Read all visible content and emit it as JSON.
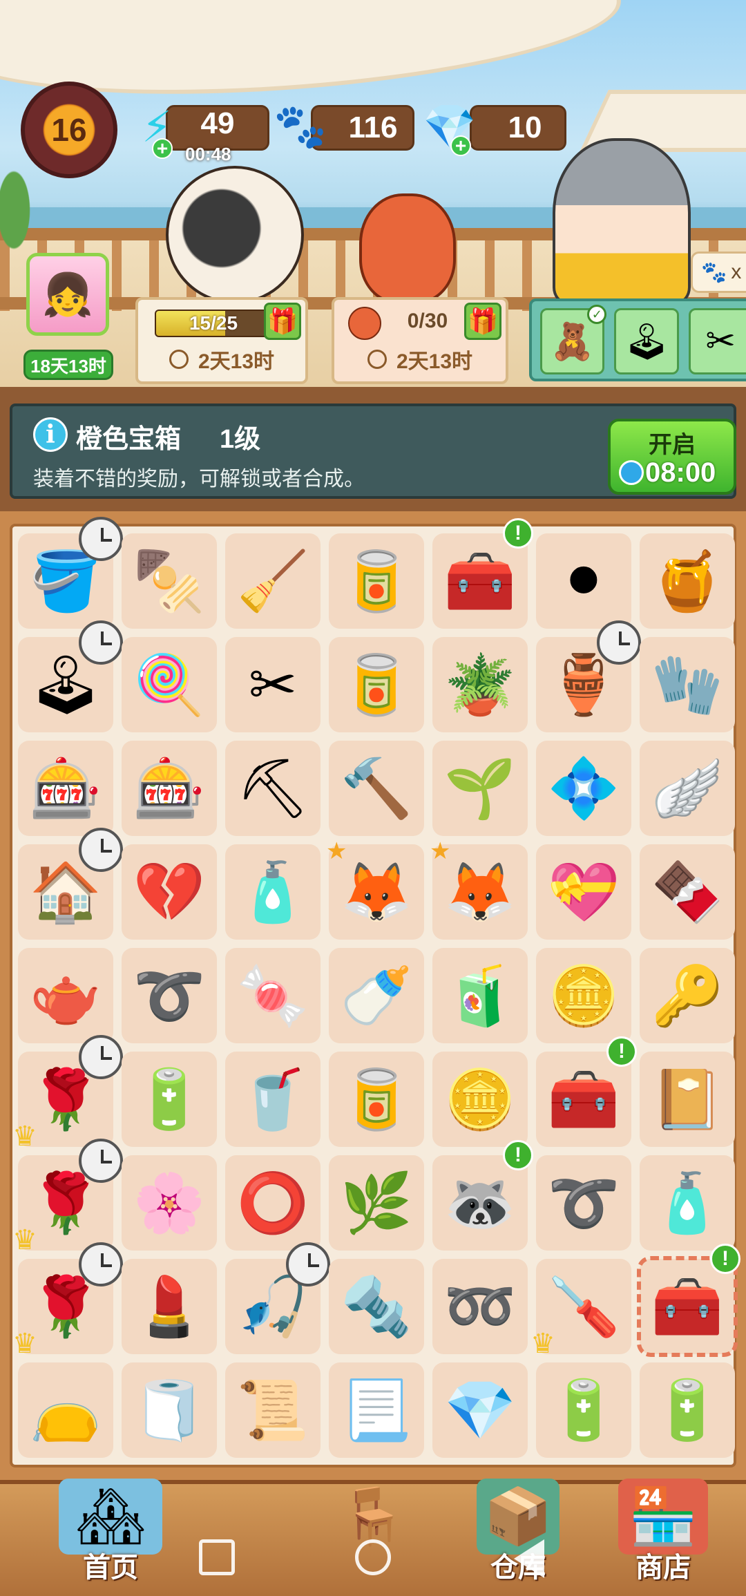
{
  "hud": {
    "level": "16",
    "energy": {
      "value": "49",
      "timer": "00:48",
      "icon": "lightning-icon"
    },
    "paws": {
      "value": "116",
      "icon": "paw-icon"
    },
    "gems": {
      "value": "10",
      "icon": "diamond-icon"
    }
  },
  "avatar": {
    "timer": "18天13时"
  },
  "events": [
    {
      "progress_text": "15/25",
      "progress": 0.6,
      "time": "2天13时"
    },
    {
      "progress_text": "0/30",
      "progress": 0.0,
      "time": "2天13时"
    }
  ],
  "paw_tag": "x",
  "info": {
    "title": "橙色宝箱",
    "level": "1级",
    "description": "装着不错的奖励，可解锁或者合成。",
    "button_label": "开启",
    "button_time": "08:00"
  },
  "board": {
    "rows": [
      [
        {
          "name": "wooden-tub",
          "icon": "🪣",
          "badge": "clock"
        },
        {
          "name": "bbq-grill",
          "icon": "🍢"
        },
        {
          "name": "rake",
          "icon": "🧹"
        },
        {
          "name": "paint-cans",
          "icon": "🥫"
        },
        {
          "name": "purple-chest",
          "icon": "🧰",
          "badge": "alert"
        },
        {
          "name": "go-board",
          "icon": "⚫"
        },
        {
          "name": "cobweb-pot",
          "icon": "🍯"
        }
      ],
      [
        {
          "name": "claw-machine-frame",
          "icon": "🕹",
          "badge": "clock"
        },
        {
          "name": "cotton-candy-machine",
          "icon": "🍭"
        },
        {
          "name": "pruning-shears",
          "icon": "✂"
        },
        {
          "name": "tin-can",
          "icon": "🥫"
        },
        {
          "name": "potted-fruit-plant",
          "icon": "🪴"
        },
        {
          "name": "bow-vase",
          "icon": "🏺",
          "badge": "clock"
        },
        {
          "name": "work-glove",
          "icon": "🧤"
        }
      ],
      [
        {
          "name": "claw-machine",
          "icon": "🎰"
        },
        {
          "name": "claw-machine",
          "icon": "🎰"
        },
        {
          "name": "shovel",
          "icon": "⛏"
        },
        {
          "name": "scraper",
          "icon": "🔨"
        },
        {
          "name": "sprout-pot",
          "icon": "🌱"
        },
        {
          "name": "glass-tray",
          "icon": "💠"
        },
        {
          "name": "rainbow-wing",
          "icon": "🪽"
        }
      ],
      [
        {
          "name": "cat-house",
          "icon": "🏠",
          "badge": "clock"
        },
        {
          "name": "broken-heart",
          "icon": "💔"
        },
        {
          "name": "spray-bottle",
          "icon": "🧴"
        },
        {
          "name": "fox-sticker",
          "icon": "🦊",
          "badge": "star"
        },
        {
          "name": "fox-goggles-sticker",
          "icon": "🦊",
          "badge": "star"
        },
        {
          "name": "rose-heart-box",
          "icon": "💝"
        },
        {
          "name": "chocolate-tray",
          "icon": "🍫"
        }
      ],
      [
        {
          "name": "gold-watering-can",
          "icon": "🫖"
        },
        {
          "name": "twine",
          "icon": "➰"
        },
        {
          "name": "candy",
          "icon": "🍬"
        },
        {
          "name": "milk-bottle",
          "icon": "🍼"
        },
        {
          "name": "water-bottle",
          "icon": "🧃"
        },
        {
          "name": "gold-paw-coins",
          "icon": "🪙"
        },
        {
          "name": "fox-keychain",
          "icon": "🔑"
        }
      ],
      [
        {
          "name": "rose-pot",
          "icon": "🌹",
          "badge": "clock",
          "crown": true
        },
        {
          "name": "battery",
          "icon": "🔋"
        },
        {
          "name": "red-drink",
          "icon": "🥤"
        },
        {
          "name": "cola-can",
          "icon": "🥫"
        },
        {
          "name": "gold-paw-coins",
          "icon": "🪙"
        },
        {
          "name": "purple-chest",
          "icon": "🧰",
          "badge": "alert"
        },
        {
          "name": "moon-book",
          "icon": "📔"
        }
      ],
      [
        {
          "name": "rose-pot",
          "icon": "🌹",
          "badge": "clock",
          "crown": true
        },
        {
          "name": "petals",
          "icon": "🌸"
        },
        {
          "name": "pet-collar",
          "icon": "⭕"
        },
        {
          "name": "crystal-plant",
          "icon": "🌿"
        },
        {
          "name": "raccoon-sticker",
          "icon": "🦝",
          "badge": "alert"
        },
        {
          "name": "string",
          "icon": "➰"
        },
        {
          "name": "cobweb-jug",
          "icon": "🧴"
        }
      ],
      [
        {
          "name": "rose-pot",
          "icon": "🌹",
          "badge": "clock",
          "crown": true
        },
        {
          "name": "lipstick",
          "icon": "💄"
        },
        {
          "name": "fishing-rod",
          "icon": "🎣",
          "badge": "clock"
        },
        {
          "name": "metal-tube",
          "icon": "🔩"
        },
        {
          "name": "rope",
          "icon": "➿"
        },
        {
          "name": "screwdriver",
          "icon": "🪛",
          "crown": true
        },
        {
          "name": "orange-chest",
          "icon": "🧰",
          "badge": "alert",
          "selected": true
        }
      ],
      [
        {
          "name": "gold-pouch",
          "icon": "👝"
        },
        {
          "name": "gold-cloth",
          "icon": "🧻"
        },
        {
          "name": "gold-scraps",
          "icon": "📜"
        },
        {
          "name": "gold-scrap",
          "icon": "📃"
        },
        {
          "name": "blue-crystals",
          "icon": "💎"
        },
        {
          "name": "small-battery",
          "icon": "🔋"
        },
        {
          "name": "large-battery",
          "icon": "🔋"
        }
      ]
    ]
  },
  "nav": {
    "home": "首页",
    "storage": "仓库",
    "shop": "商店"
  },
  "colors": {
    "board_cell": "#f3d9c3",
    "accent_green": "#3fb42e",
    "frame_brown": "#c9894e"
  }
}
